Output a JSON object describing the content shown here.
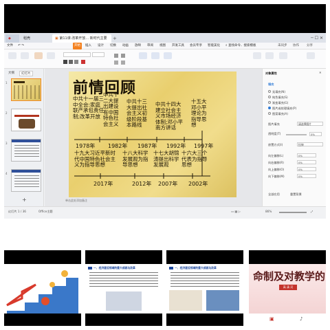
{
  "window": {
    "tabs": [
      {
        "label": "稻壳"
      },
      {
        "label": "第11课 改革开放... 新时代主要任务"
      }
    ],
    "add_tab": "+"
  },
  "menubar": {
    "items": [
      "文件",
      "开始",
      "插入",
      "设计",
      "切换",
      "动画",
      "放映",
      "审阅",
      "视图",
      "开发工具",
      "会员专享",
      "智能美化"
    ],
    "active": "开始",
    "search_placeholder": "查找命令、搜索模板",
    "right": [
      "未同步",
      "协作",
      "分享"
    ]
  },
  "left_panel": {
    "tabs": [
      "大纲",
      "幻灯片"
    ],
    "slides": [
      "1",
      "2",
      "3",
      "4"
    ]
  },
  "slide": {
    "title": "前情回顾",
    "top_items": [
      "中共十一届三中全会:家庭联产承包责任制;改革开放",
      "中共十二大提出建设有中国特色社会主义",
      "中共十三大提出社会主义初级阶段基本路线",
      "中共十四大建立社会主义市场经济体制;邓小平南方讲话",
      "十五大邓小平理论为指导思想"
    ],
    "top_years": [
      "1978年",
      "1982年",
      "1987年",
      "1992年",
      "1997年"
    ],
    "bottom_items": [
      "十九大习近平新时代中国特色社会主义为指导思想",
      "十八大科学发展观为指导思想",
      "十七大胡锦涛提出科学发展观",
      "十六大三个代表为指导思想"
    ],
    "bottom_years": [
      "2017年",
      "2012年",
      "2007年",
      "2002年"
    ],
    "note_placeholder": "单击此处添加备注"
  },
  "right_panel": {
    "header": "对象属性",
    "section_fill": "填充",
    "fill_options": [
      "无填充(N)",
      "纯色填充(S)",
      "渐变填充(G)",
      "图片或纹理填充(P)",
      "图案填充(A)"
    ],
    "selected_fill": "图片或纹理填充(P)",
    "image_fill_label": "图片填充",
    "image_fill_value": "请选择图片",
    "transparency_label": "透明度(T)",
    "transparency_value": "0%",
    "tile_label": "放置方式(I)",
    "tile_value": "拉伸",
    "offset_left": "向左偏移(L)",
    "offset_right": "向右偏移(R)",
    "offset_up": "向上偏移(O)",
    "offset_down": "向下偏移(M)",
    "offset_value": "0%",
    "apply_all": "全部应用",
    "reset": "重置背景"
  },
  "statusbar": {
    "slide_count": "幻灯片 1 / 36",
    "theme": "Office主题",
    "zoom": "86%"
  },
  "cards": {
    "c2_title": "一、经济建设领域的重大成就与改革",
    "c3_title": "一、经济建设领域的重大成就与改革",
    "c4_text": "命制及对教学的",
    "c4_badge": "高 清 河"
  },
  "colors": {
    "accent": "#f4811f",
    "slide_bg": "#ecd37a",
    "selection": "#2f7bd6"
  }
}
